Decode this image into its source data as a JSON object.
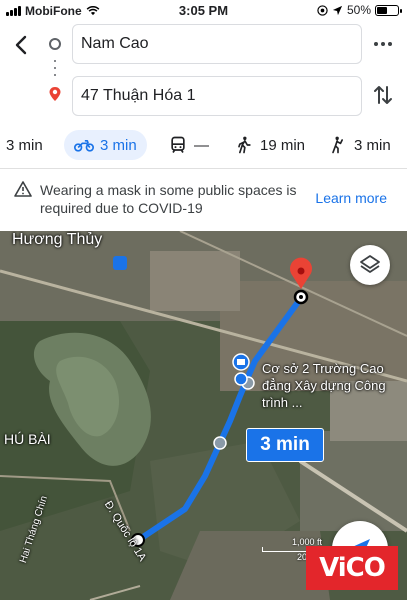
{
  "status_bar": {
    "carrier": "MobiFone",
    "time": "3:05 PM",
    "battery": "50%"
  },
  "search": {
    "origin": "Nam Cao",
    "destination": "47 Thuận Hóa 1"
  },
  "modes": [
    {
      "name": "car",
      "label": "3 min",
      "active": false
    },
    {
      "name": "motorbike",
      "label": "3 min",
      "active": true
    },
    {
      "name": "transit",
      "label": "—",
      "active": false
    },
    {
      "name": "walk",
      "label": "19 min",
      "active": false
    },
    {
      "name": "ride",
      "label": "3 min",
      "active": false
    }
  ],
  "banner": {
    "text": "Wearing a mask in some public spaces is required due to COVID-19",
    "action": "Learn more"
  },
  "map": {
    "labels": {
      "huong_thuy": "Hương Thủy",
      "hai_thang_chin": "Hai Tháng Chín",
      "hu_bai": "HÚ BÀI",
      "duong_1a": "Đ. Quốc lộ 1A"
    },
    "place_label": "Cơ sở 2 Trường Cao đẳng Xây dựng Công trình ...",
    "route_time": "3 min",
    "scale_top": "1,000 ft",
    "scale_bottom": "200 m",
    "route_color": "#1a73e8",
    "pin_color": "#ea4335"
  },
  "watermark": "ViCO"
}
